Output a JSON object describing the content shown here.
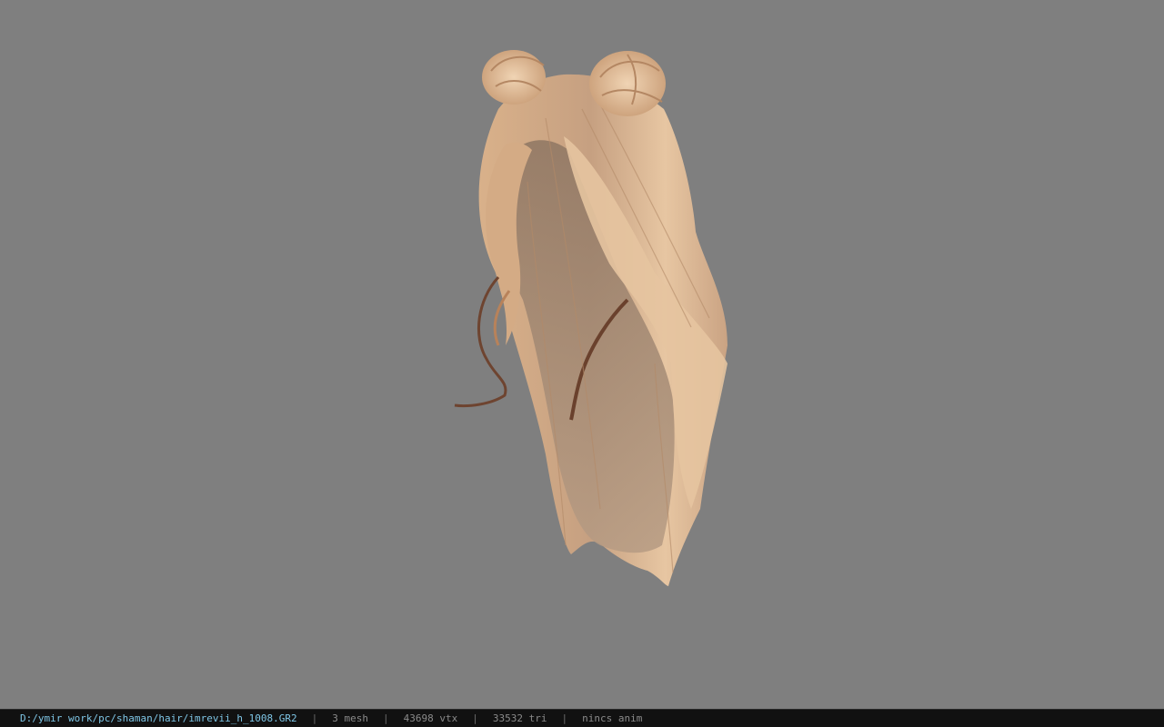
{
  "viewer": {
    "background_color": "#7f7f7f"
  },
  "model": {
    "icon": "hair-model-icon",
    "colors": {
      "hair_light": "#e9c9a4",
      "hair_mid": "#c9a07c",
      "hair_dark": "#7a4e34",
      "hair_shadow": "#8e7663"
    }
  },
  "statusbar": {
    "file_path": "D:/ymir work/pc/shaman/hair/imrevii_h_1008.GR2",
    "separator": "|",
    "mesh_count": "3 mesh",
    "vertex_count": "43698 vtx",
    "triangle_count": "33532 tri",
    "anim_status": "nincs anim",
    "path_color": "#7fc6e6",
    "text_color": "#8a8a8a",
    "background_color": "#111111"
  }
}
